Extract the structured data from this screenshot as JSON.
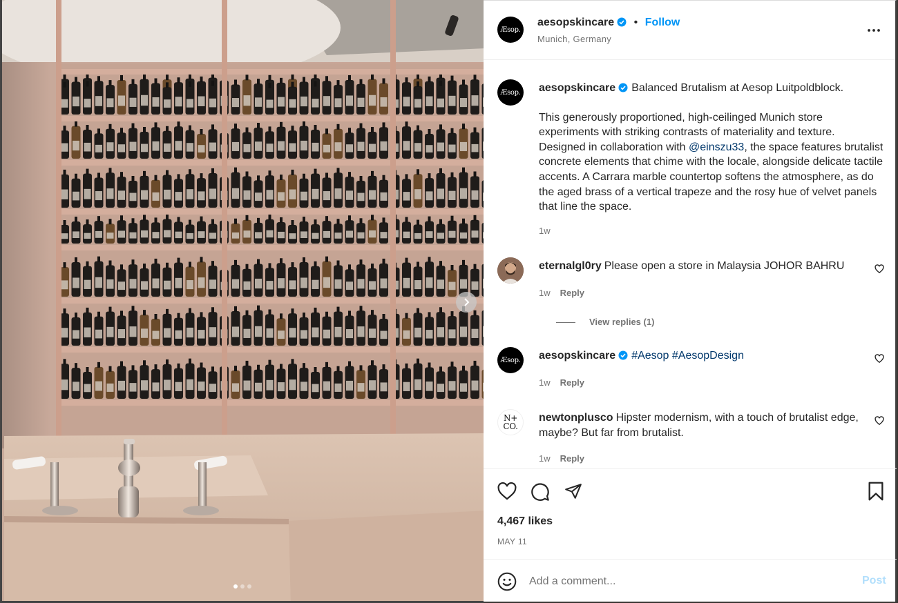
{
  "post": {
    "author": "aesopskincare",
    "avatar_text": "Æsop.",
    "separator": "•",
    "follow_label": "Follow",
    "location": "Munich, Germany"
  },
  "caption": {
    "username": "aesopskincare",
    "first_line": "Balanced Brutalism at Aesop Luitpoldblock.",
    "body_before_mention": "This generously proportioned, high-ceilinged Munich store experiments with striking contrasts of materiality and texture. Designed in collaboration with ",
    "mention": "@einszu33",
    "body_after_mention": ", the space features brutalist concrete elements that chime with the locale, alongside delicate tactile accents. A Carrara marble countertop softens the atmosphere, as do the aged brass of a vertical trapeze and the rosy hue of velvet panels that line the space.",
    "time": "1w"
  },
  "comments": [
    {
      "username": "eternalgl0ry",
      "text": "Please open a store in Malaysia JOHOR BAHRU",
      "time": "1w",
      "reply_label": "Reply",
      "view_replies": "View replies (1)"
    },
    {
      "username": "aesopskincare",
      "avatar_text": "Æsop.",
      "tags": "#Aesop #AesopDesign",
      "time": "1w",
      "reply_label": "Reply"
    },
    {
      "username": "newtonplusco",
      "avatar_text_1": "N+",
      "avatar_text_2": "CO.",
      "text": "Hipster modernism, with a touch of brutalist edge, maybe? But far from brutalist.",
      "time": "1w",
      "reply_label": "Reply"
    }
  ],
  "likes": "4,467 likes",
  "date": "MAY 11",
  "composer": {
    "placeholder": "Add a comment...",
    "post_label": "Post"
  },
  "carousel": {
    "total_slides": 3,
    "active_slide": 1
  },
  "colors": {
    "accent": "#0095f6",
    "link": "#00376b",
    "muted": "#737373",
    "post_disabled": "#b2dffc",
    "verified": "#0095f6"
  },
  "icons": [
    "verified-badge-icon",
    "more-options-icon",
    "heart-icon",
    "comment-icon",
    "share-icon",
    "bookmark-icon",
    "emoji-icon",
    "carousel-next-icon"
  ]
}
